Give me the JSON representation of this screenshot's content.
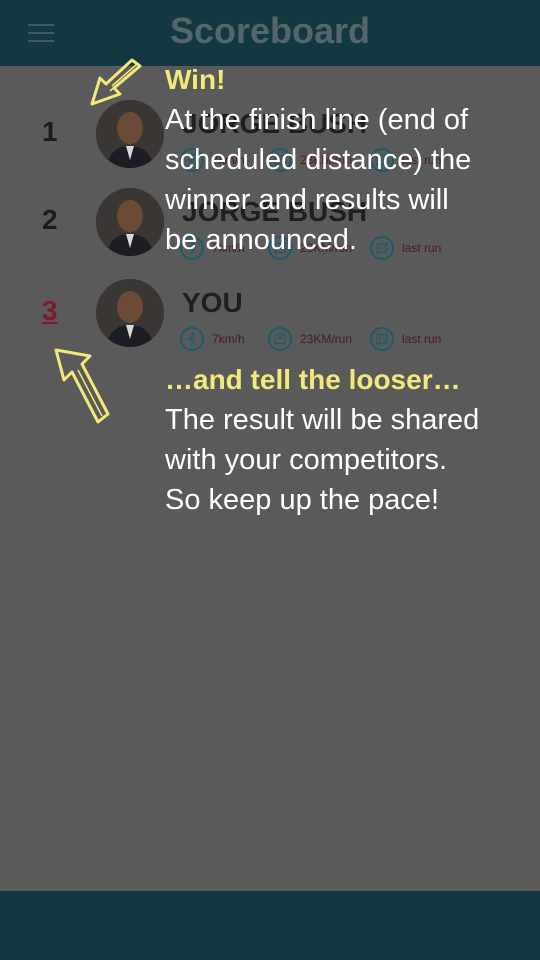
{
  "header": {
    "title": "Scoreboard",
    "menu_icon": "hamburger-menu-icon"
  },
  "rows": [
    {
      "rank": "1",
      "name": "JORGE BUSH",
      "speed": "7km/h",
      "distance": "23KM/run",
      "last": "last run"
    },
    {
      "rank": "2",
      "name": "JORGE BUSH",
      "speed": "7km/h",
      "distance": "23KM/run",
      "last": "last run"
    },
    {
      "rank": "3",
      "name": "YOU",
      "speed": "7km/h",
      "distance": "23KM/run",
      "last": "last run"
    }
  ],
  "overlay": {
    "win_heading": "Win!",
    "win_lines": [
      "At the finish line (end of",
      "scheduled distance) the",
      "winner and results will",
      "be announced."
    ],
    "loser_heading": "…and tell the looser…",
    "loser_lines": [
      "The result will be shared",
      "with your competitors.",
      "So keep up the pace!"
    ]
  },
  "colors": {
    "topbar": "#143841",
    "overlay_bg": "#5a5a5a",
    "highlight": "#f3e87a",
    "rank_you": "#7a1c2a"
  }
}
